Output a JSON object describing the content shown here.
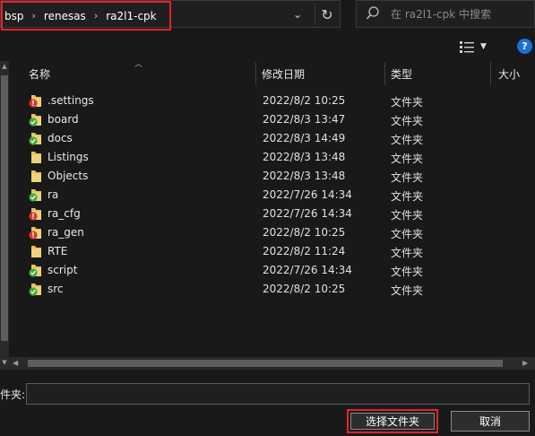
{
  "address": {
    "crumbs": [
      "bsp",
      "renesas",
      "ra2l1-cpk"
    ],
    "separator": "›",
    "dropdown_icon": "chevron-down-icon",
    "refresh_icon": "refresh-icon"
  },
  "search": {
    "placeholder": "在 ra2l1-cpk 中搜索"
  },
  "toolbar": {
    "help_label": "?"
  },
  "columns": {
    "name": "名称",
    "date": "修改日期",
    "type": "类型",
    "size": "大小"
  },
  "files": [
    {
      "name": ".settings",
      "date": "2022/8/2 10:25",
      "type": "文件夹",
      "status": "conflict"
    },
    {
      "name": "board",
      "date": "2022/8/3 13:47",
      "type": "文件夹",
      "status": "ok"
    },
    {
      "name": "docs",
      "date": "2022/8/3 14:49",
      "type": "文件夹",
      "status": "ok"
    },
    {
      "name": "Listings",
      "date": "2022/8/3 13:48",
      "type": "文件夹",
      "status": "none"
    },
    {
      "name": "Objects",
      "date": "2022/8/3 13:48",
      "type": "文件夹",
      "status": "none"
    },
    {
      "name": "ra",
      "date": "2022/7/26 14:34",
      "type": "文件夹",
      "status": "ok"
    },
    {
      "name": "ra_cfg",
      "date": "2022/7/26 14:34",
      "type": "文件夹",
      "status": "conflict"
    },
    {
      "name": "ra_gen",
      "date": "2022/8/2 10:25",
      "type": "文件夹",
      "status": "conflict"
    },
    {
      "name": "RTE",
      "date": "2022/8/2 11:24",
      "type": "文件夹",
      "status": "none"
    },
    {
      "name": "script",
      "date": "2022/7/26 14:34",
      "type": "文件夹",
      "status": "ok"
    },
    {
      "name": "src",
      "date": "2022/8/2 10:25",
      "type": "文件夹",
      "status": "ok"
    }
  ],
  "footer": {
    "folder_label": "件夹:",
    "folder_value": "",
    "select_button": "选择文件夹",
    "cancel_button": "取消"
  },
  "colors": {
    "folder": "#e8c15a",
    "ok_badge": "#3fae3a",
    "conflict_badge": "#d9372b",
    "highlight_border": "#e0242b",
    "help_blue": "#1a6fd8"
  }
}
